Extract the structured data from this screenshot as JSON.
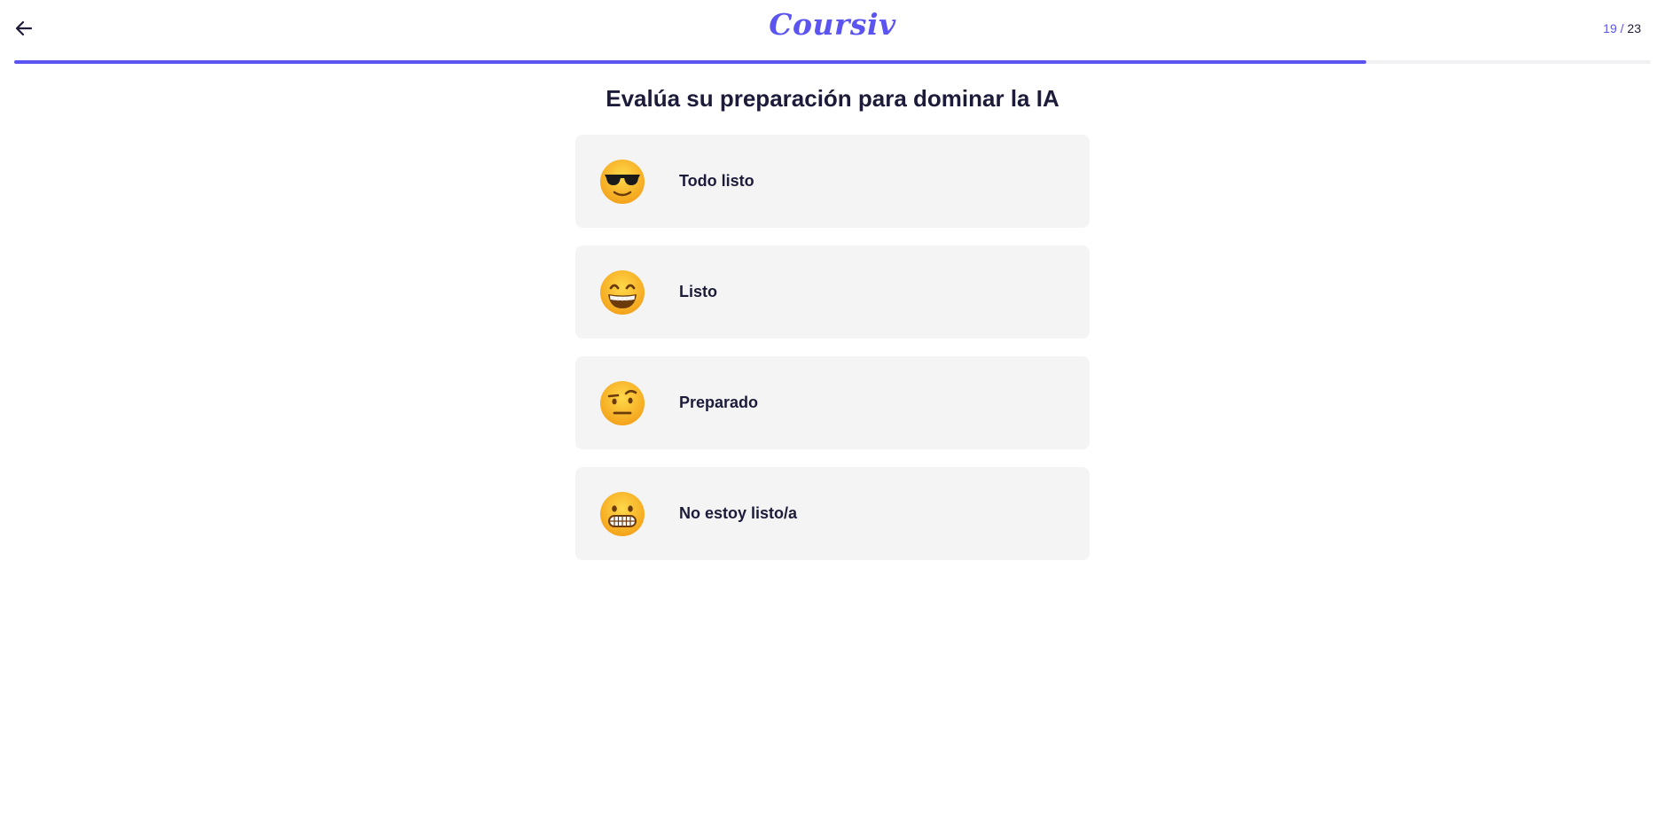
{
  "header": {
    "logo_text": "Coursiv",
    "step_current": "19",
    "step_separator": " / ",
    "step_total": "23",
    "progress_fraction": 0.8261,
    "accent_color": "#5b54f0"
  },
  "question": {
    "title": "Evalúa su preparación para dominar la IA"
  },
  "options": [
    {
      "label": "Todo listo",
      "icon": "smiling-face-with-sunglasses-icon"
    },
    {
      "label": "Listo",
      "icon": "beaming-face-icon"
    },
    {
      "label": "Preparado",
      "icon": "face-with-raised-eyebrow-icon"
    },
    {
      "label": "No estoy listo/a",
      "icon": "grimacing-face-icon"
    }
  ]
}
